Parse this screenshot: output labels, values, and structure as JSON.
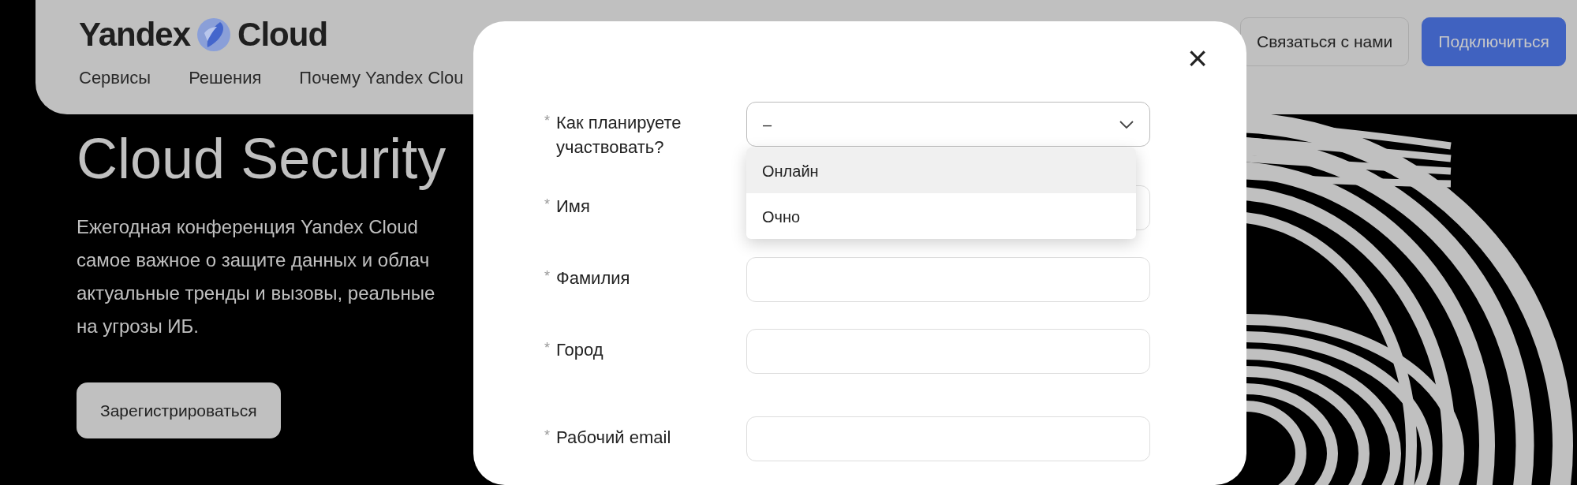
{
  "header": {
    "logo": {
      "word_left": "Yandex",
      "word_right": "Cloud"
    },
    "nav": [
      "Сервисы",
      "Решения",
      "Почему Yandex Clou"
    ],
    "buttons": [
      {
        "label": "Связаться с нами",
        "kind": "outline"
      },
      {
        "label": "Подключиться",
        "kind": "primary"
      }
    ]
  },
  "hero": {
    "title": "Cloud Security",
    "text": "Ежегодная конференция Yandex Cloud\nсамое важное о защите данных и облач\nактуальные тренды и вызовы, реальные\nна угрозы ИБ.",
    "button": "Зарегистрироваться"
  },
  "modal": {
    "close": "×",
    "fields": [
      {
        "kind": "select",
        "marker": "*",
        "label": "Как планируете участвовать?",
        "value": "–",
        "expanded": true,
        "options": [
          {
            "label": "Онлайн",
            "highlighted": true
          },
          {
            "label": "Очно",
            "highlighted": false
          }
        ]
      },
      {
        "kind": "text",
        "marker": "*",
        "label": "Имя"
      },
      {
        "kind": "text",
        "marker": "*",
        "label": "Фамилия"
      },
      {
        "kind": "text",
        "marker": "*",
        "label": "Город"
      },
      {
        "kind": "text",
        "marker": "*",
        "label": "Рабочий email"
      }
    ]
  }
}
